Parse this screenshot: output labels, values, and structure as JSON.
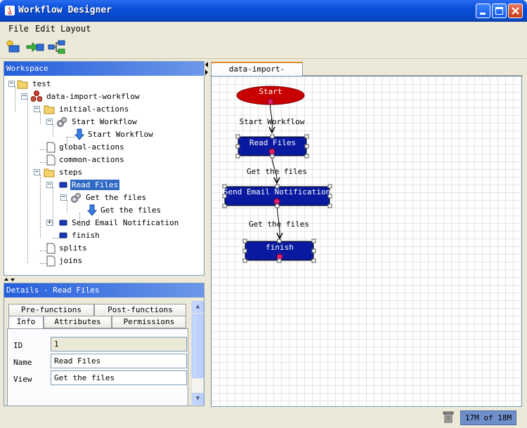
{
  "window": {
    "title": "Workflow Designer"
  },
  "menu": {
    "file": "File",
    "edit": "Edit",
    "layout": "Layout"
  },
  "toolbar": {
    "icons": [
      "new-workflow-icon",
      "import-icon",
      "layout-icon"
    ]
  },
  "workspace": {
    "title": "Workspace",
    "tree": {
      "root": "test",
      "workflow": "data-import-workflow",
      "initial_actions": "initial-actions",
      "start_workflow": "Start Workflow",
      "start_workflow_result": "Start Workflow",
      "global_actions": "global-actions",
      "common_actions": "common-actions",
      "steps": "steps",
      "read_files": "Read Files",
      "get_files_action": "Get the files",
      "get_files_result": "Get the files",
      "send_email": "Send Email Notification",
      "finish": "finish",
      "splits": "splits",
      "joins": "joins"
    }
  },
  "details": {
    "title": "Details - Read Files",
    "tabs_row1": [
      "Pre-functions",
      "Post-functions"
    ],
    "tabs_row2": [
      "Info",
      "Attributes",
      "Permissions"
    ],
    "active_tab": "Info",
    "fields": {
      "id_label": "ID",
      "id_value": "1",
      "name_label": "Name",
      "name_value": "Read Files",
      "view_label": "View",
      "view_value": "Get the files"
    }
  },
  "editor": {
    "tab": "data-import-workflow",
    "diagram": {
      "start": "Start",
      "start_arrow_label": "Start Workflow",
      "read_files": "Read Files",
      "arrow2_label": "Get the files",
      "send_email": "Send Email Notification",
      "arrow3_label": "Get the files",
      "finish": "finish"
    }
  },
  "status": {
    "memory": "17M of 18M"
  },
  "colors": {
    "node_fill": "#0a1aa0",
    "start_fill": "#c80000",
    "selection": "#316ac5",
    "titlebar": "#0a4fd8"
  }
}
